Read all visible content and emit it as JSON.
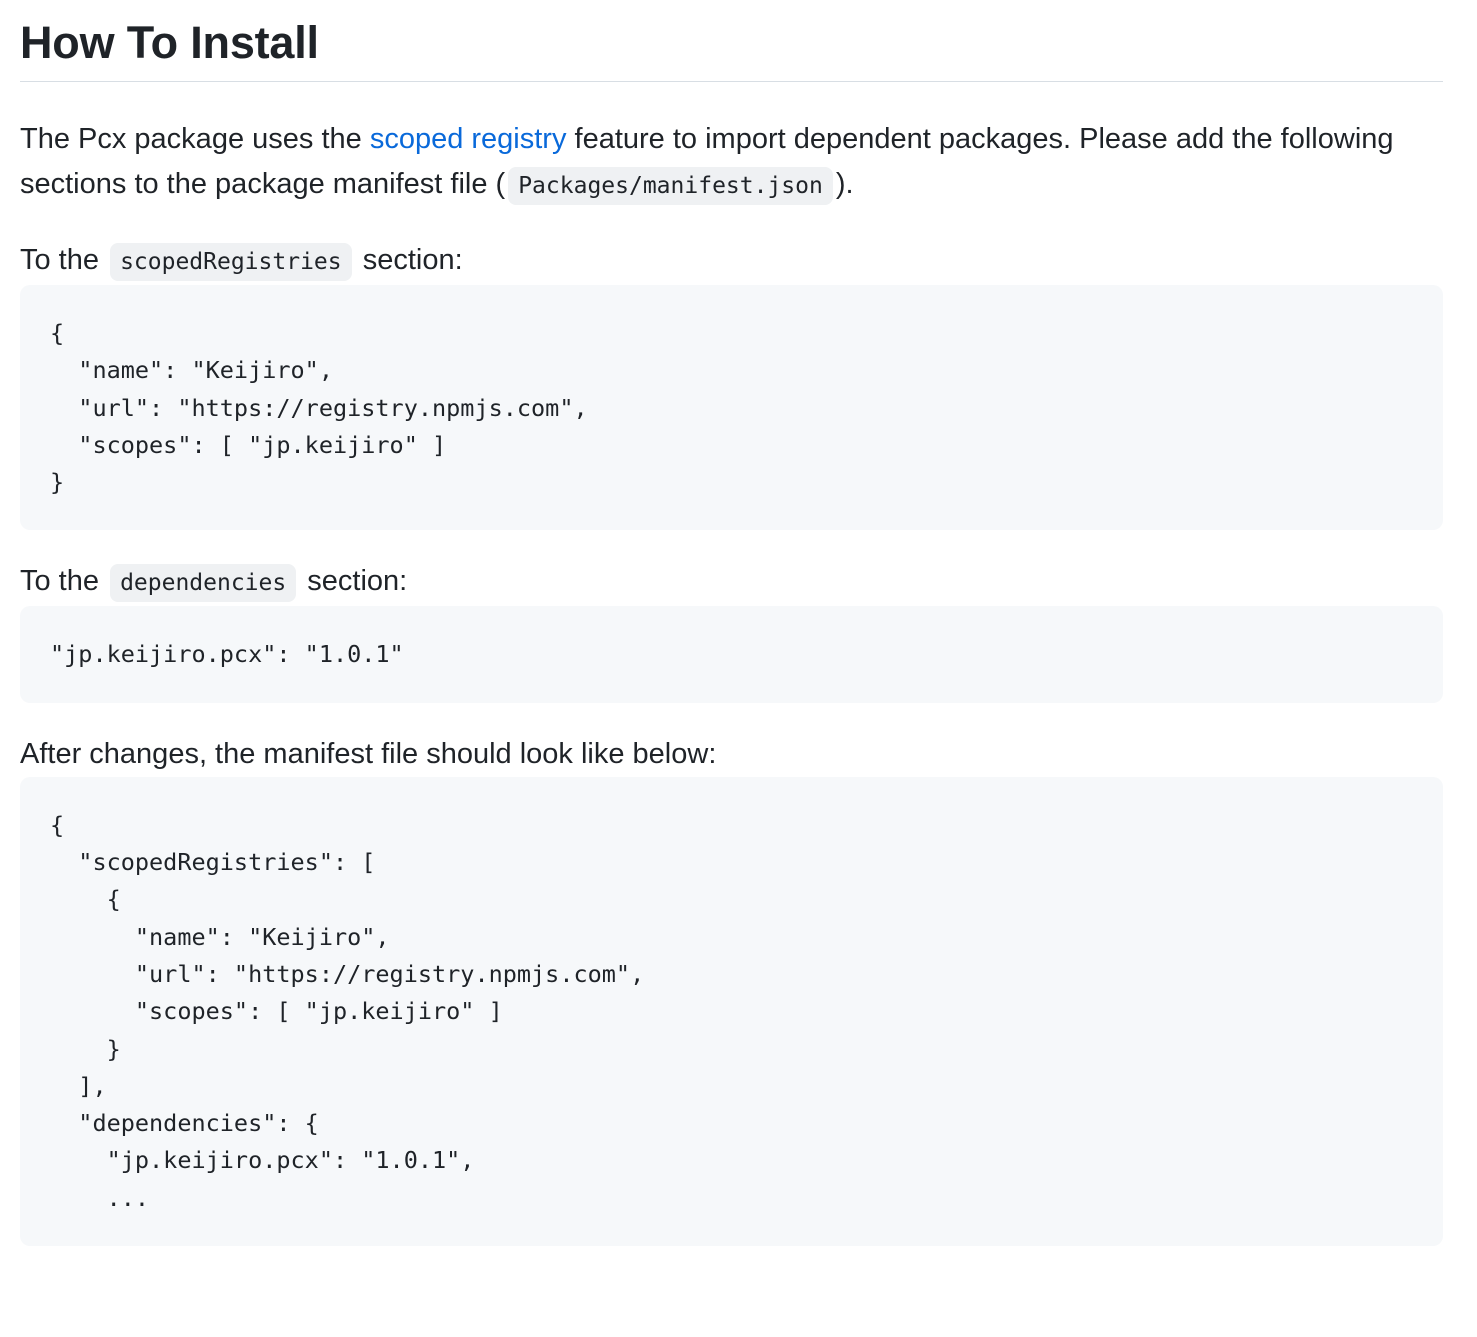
{
  "heading": "How To Install",
  "intro": {
    "text_before_link": "The Pcx package uses the ",
    "link_text": "scoped registry",
    "text_after_link": " feature to import dependent packages. Please add the following sections to the package manifest file (",
    "code": "Packages/manifest.json",
    "text_end": ")."
  },
  "scoped_section": {
    "prefix": "To the",
    "code": "scopedRegistries",
    "suffix": "section:",
    "code_block": "{\n  \"name\": \"Keijiro\",\n  \"url\": \"https://registry.npmjs.com\",\n  \"scopes\": [ \"jp.keijiro\" ]\n}"
  },
  "dependencies_section": {
    "prefix": "To the",
    "code": "dependencies",
    "suffix": "section:",
    "code_block": "\"jp.keijiro.pcx\": \"1.0.1\""
  },
  "after_section": {
    "text": "After changes, the manifest file should look like below:",
    "code_block": "{\n  \"scopedRegistries\": [\n    {\n      \"name\": \"Keijiro\",\n      \"url\": \"https://registry.npmjs.com\",\n      \"scopes\": [ \"jp.keijiro\" ]\n    }\n  ],\n  \"dependencies\": {\n    \"jp.keijiro.pcx\": \"1.0.1\",\n    ..."
  },
  "colors": {
    "text": "#1f2328",
    "link": "#0969da",
    "code_block_bg": "#f6f8fa",
    "inline_code_bg": "#eff1f3",
    "divider": "#d8dee4"
  }
}
